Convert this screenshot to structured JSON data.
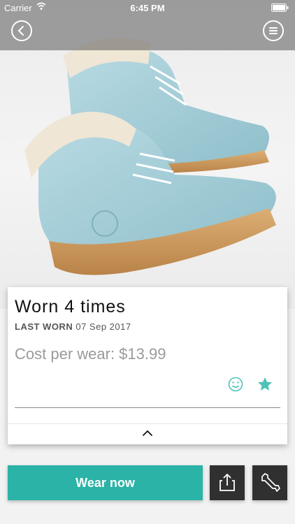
{
  "status_bar": {
    "carrier": "Carrier",
    "time": "6:45 PM"
  },
  "header": {
    "back_icon": "chevron-left-icon",
    "menu_icon": "menu-icon"
  },
  "hero": {
    "image": "light-blue boots on snow"
  },
  "card": {
    "worn_title": "Worn 4 times",
    "last_worn_label": "LAST WORN",
    "last_worn_date": "07 Sep 2017",
    "cost_per_wear": "Cost per wear: $13.99",
    "smile_icon": "smile-icon",
    "star_icon": "star-icon",
    "expand_icon": "chevron-up-icon"
  },
  "actions": {
    "wear_now_label": "Wear now",
    "share_icon": "share-icon",
    "wrench_icon": "wrench-icon"
  },
  "colors": {
    "accent": "#2ab3a6",
    "dark_button": "#303030",
    "header_overlay": "#5a5a5a"
  }
}
